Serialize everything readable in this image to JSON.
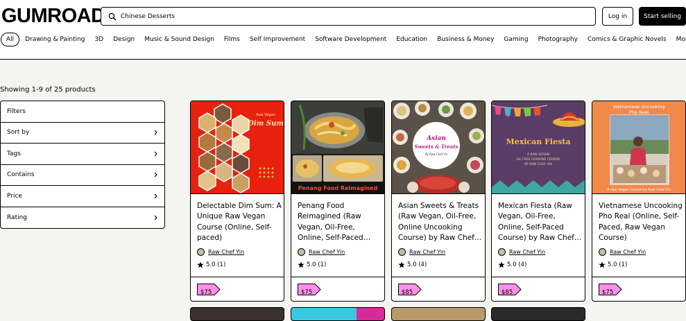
{
  "brand": {
    "logo_text": "GUMROAD"
  },
  "search": {
    "value": "Chinese Desserts"
  },
  "header": {
    "login_label": "Log in",
    "sell_label": "Start selling"
  },
  "nav": {
    "items": [
      "All",
      "Drawing & Painting",
      "3D",
      "Design",
      "Music & Sound Design",
      "Films",
      "Self Improvement",
      "Software Development",
      "Education",
      "Business & Money",
      "Gaming",
      "Photography",
      "Comics & Graphic Novels"
    ],
    "active_index": 0,
    "more_label": "More"
  },
  "results": {
    "showing_text": "Showing 1-9 of 25 products"
  },
  "filters": {
    "heading": "Filters",
    "rows": [
      "Sort by",
      "Tags",
      "Contains",
      "Price",
      "Rating"
    ]
  },
  "products": [
    {
      "title": "Delectable Dim Sum: A Unique Raw Vegan Course (Online, Self-paced)",
      "creator": "Raw Chef Yin",
      "rating": "5.0 (1)",
      "price": "$75",
      "thumb_text": [
        "Raw Vegan",
        "Dim Sum"
      ]
    },
    {
      "title": "Penang Food Reimagined (Raw Vegan, Oil-Free, Online, Self-Paced…",
      "creator": "Raw Chef Yin",
      "rating": "5.0 (1)",
      "price": "$75",
      "thumb_text": [
        "Penang Food Reimagined"
      ]
    },
    {
      "title": "Asian Sweets & Treats (Raw Vegan, Oil-Free, Online Uncooking Course) by Raw Chef…",
      "creator": "Raw Chef Yin",
      "rating": "5.0 (4)",
      "price": "$85",
      "thumb_text": [
        "Asian",
        "Sweets & Treats",
        "By Raw Chef Yin"
      ]
    },
    {
      "title": "Mexican Fiesta (Raw Vegan, Oil-Free, Online, Self-Paced Course) by Raw Chef…",
      "creator": "Raw Chef Yin",
      "rating": "5.0 (4)",
      "price": "$85",
      "thumb_text": [
        "Mexican Fiesta",
        "A RAW VEGAN",
        "OIL FREE COOKING COURSE",
        "BY RAW CHEF YIN"
      ]
    },
    {
      "title": "Vietnamese Uncooking Pho Real (Online, Self-Paced, Raw Vegan Course)",
      "creator": "Raw Chef Yin",
      "rating": "5.0 (1)",
      "price": "$75",
      "thumb_text": [
        "Vietnamese Uncooking",
        "Pho Real",
        "A raw vegan course by Raw Chef Yin"
      ]
    }
  ],
  "colors": {
    "page_bg": "#f4f4f0",
    "price_tag": "#ff90e8",
    "dimsum_red": "#e8210f",
    "mexican_purple": "#5a3d66",
    "vietnam_orange": "#f08a4b"
  }
}
